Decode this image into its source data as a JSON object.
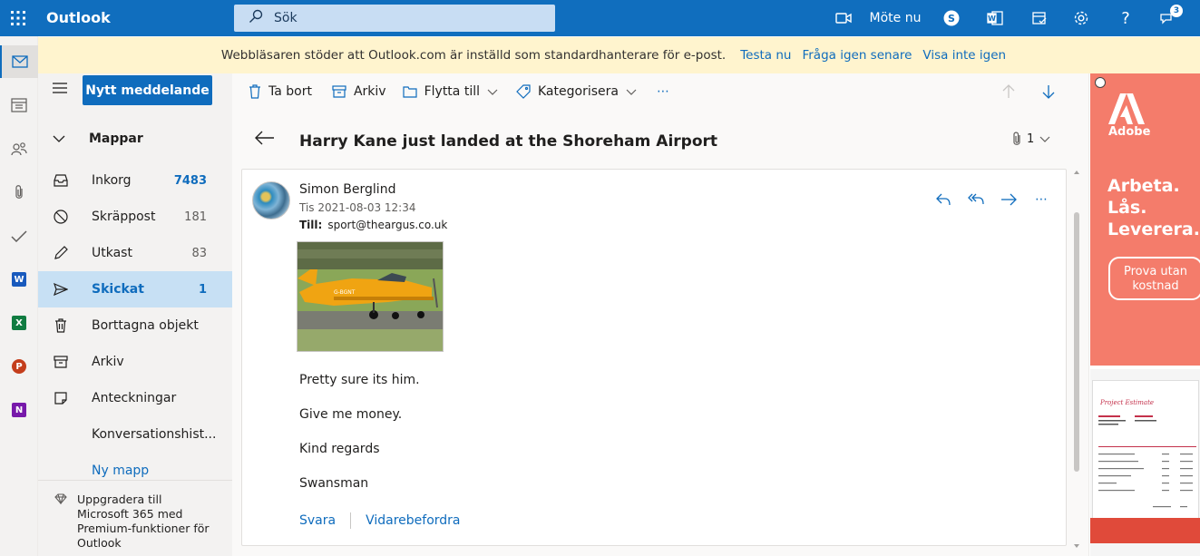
{
  "app": {
    "title": "Outlook"
  },
  "search": {
    "placeholder": "Sök"
  },
  "topbar": {
    "meet_label": "Möte nu",
    "notification_count": "3"
  },
  "banner": {
    "message": "Webbläsaren stöder att Outlook.com är inställd som standardhanterare för e-post.",
    "try_now": "Testa nu",
    "ask_later": "Fråga igen senare",
    "never_show": "Visa inte igen"
  },
  "folders": {
    "new_message": "Nytt meddelande",
    "header": "Mappar",
    "items": [
      {
        "name": "Inkorg",
        "count": "7483",
        "icon": "inbox-icon"
      },
      {
        "name": "Skräppost",
        "count": "181",
        "icon": "junk-icon"
      },
      {
        "name": "Utkast",
        "count": "83",
        "icon": "drafts-pencil-icon"
      },
      {
        "name": "Skickat",
        "count": "1",
        "icon": "sent-icon"
      },
      {
        "name": "Borttagna objekt",
        "count": "",
        "icon": "trash-icon"
      },
      {
        "name": "Arkiv",
        "count": "",
        "icon": "archive-icon"
      },
      {
        "name": "Anteckningar",
        "count": "",
        "icon": "notes-icon"
      },
      {
        "name": "Konversationshist...",
        "count": "",
        "icon": ""
      }
    ],
    "new_folder": "Ny mapp",
    "upgrade": "Uppgradera till Microsoft 365 med Premium-funktioner för Outlook"
  },
  "commands": {
    "delete": "Ta bort",
    "archive": "Arkiv",
    "move_to": "Flytta till",
    "categorize": "Kategorisera",
    "more": "⋯"
  },
  "message": {
    "subject": "Harry Kane just landed at the Shoreham Airport",
    "attachment_count": "1",
    "sender": "Simon Berglind",
    "date": "Tis 2021-08-03 12:34",
    "to_label": "Till:",
    "to_address": "sport@theargus.co.uk",
    "image_registration": "G-BGNT",
    "body": [
      "Pretty sure its him.",
      "Give me money.",
      "Kind regards",
      "Swansman"
    ],
    "reply": "Svara",
    "forward": "Vidarebefordra"
  },
  "ad": {
    "brand": "Adobe",
    "headline_lines": [
      "Arbeta.",
      "Lås.",
      "Leverera."
    ],
    "cta": "Prova utan kostnad",
    "doc_title": "Project Estimate"
  },
  "colors": {
    "accent": "#0f6cbd",
    "topbar": "#106ebe",
    "banner": "#fff4ce",
    "ad": "#f47c6b"
  }
}
